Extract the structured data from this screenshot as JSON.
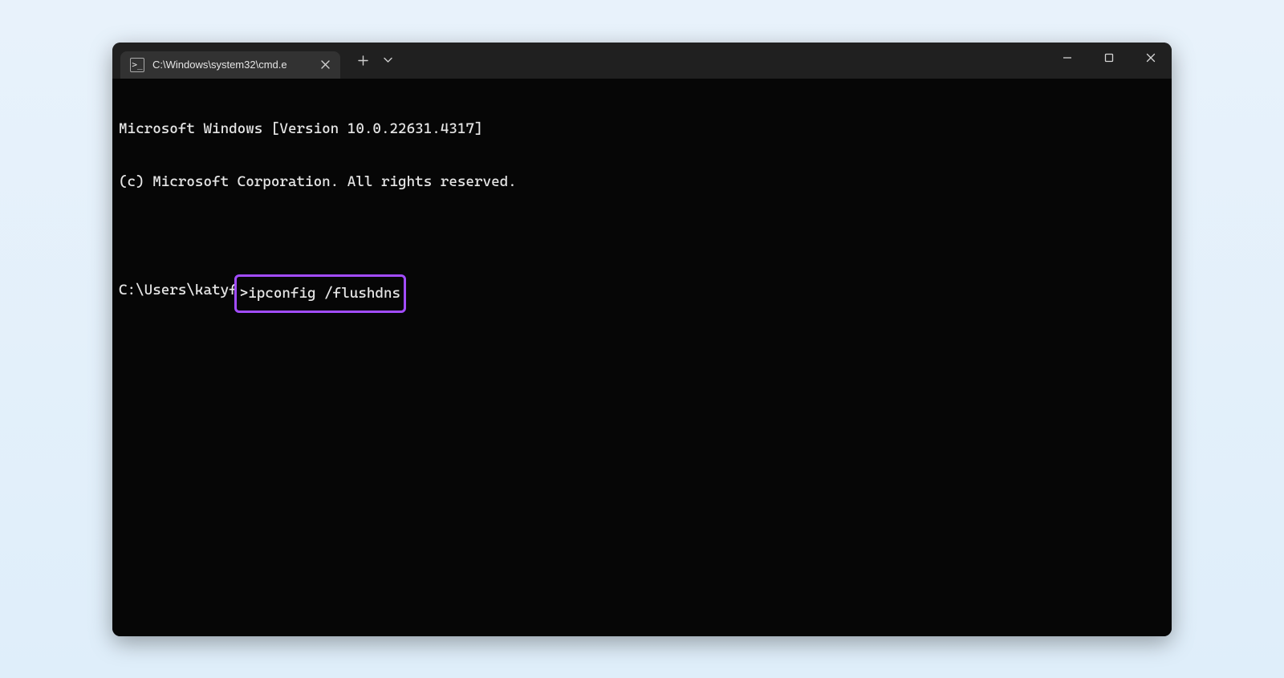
{
  "titlebar": {
    "tab_title": "C:\\Windows\\system32\\cmd.e",
    "new_tab_tooltip": "New tab",
    "dropdown_tooltip": "Open a new tab",
    "minimize_tooltip": "Minimize",
    "maximize_tooltip": "Maximize",
    "close_tooltip": "Close"
  },
  "terminal": {
    "line1": "Microsoft Windows [Version 10.0.22631.4317]",
    "line2": "(c) Microsoft Corporation. All rights reserved.",
    "prompt_prefix": "C:\\Users\\katyf",
    "prompt_symbol": ">",
    "command": "ipconfig /flushdns"
  },
  "annotation": {
    "highlight_color": "#a24cff"
  }
}
